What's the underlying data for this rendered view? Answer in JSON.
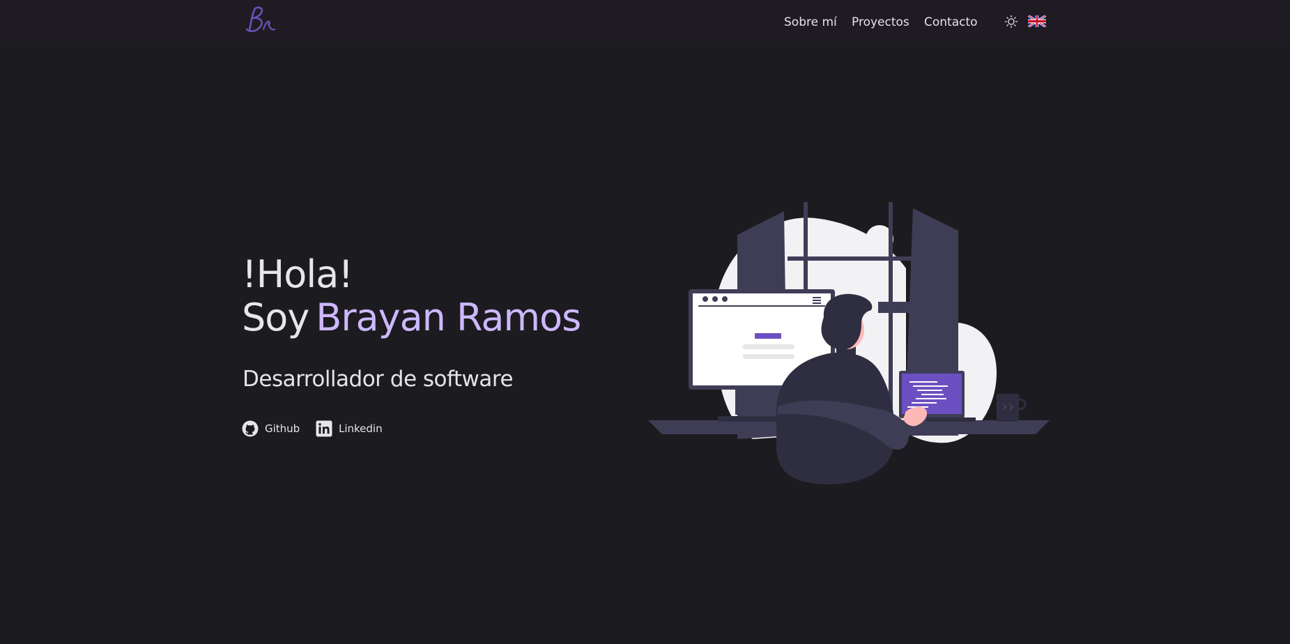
{
  "header": {
    "logo_text": "Br",
    "nav": {
      "about": "Sobre mí",
      "projects": "Proyectos",
      "contact": "Contacto"
    },
    "theme_icon": "sun-icon",
    "language_icon": "uk-flag-icon"
  },
  "hero": {
    "greeting": "!Hola!",
    "intro_prefix": "Soy",
    "name": "Brayan Ramos",
    "role": "Desarrollador de software",
    "links": {
      "github": "Github",
      "linkedin": "Linkedin"
    }
  },
  "colors": {
    "background": "#1c1b1f",
    "header_background": "#1f1b22",
    "accent": "#cdb8ff",
    "illustration_purple": "#6c4fc0",
    "illustration_dark": "#3f3d56"
  }
}
